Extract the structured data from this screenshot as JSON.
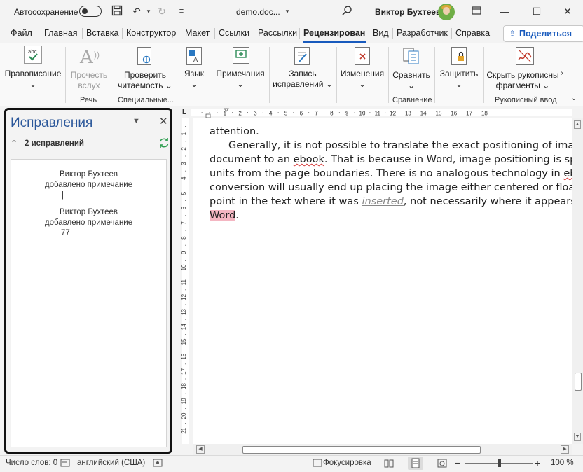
{
  "titlebar": {
    "autosave_label": "Автосохранение",
    "doc_name": "demo.doc...",
    "user_name": "Виктор Бухтеев"
  },
  "tabs": [
    "Файл",
    "Главная",
    "Вставка",
    "Конструктор",
    "Макет",
    "Ссылки",
    "Рассылки",
    "Рецензировани",
    "Вид",
    "Разработчик",
    "Справка"
  ],
  "share_label": "Поделиться",
  "ribbon": {
    "spelling": "Правописание",
    "read_aloud_1": "Прочесть",
    "read_aloud_2": "вслух",
    "check_1": "Проверить",
    "check_2": "читаемость",
    "language": "Язык",
    "comments": "Примечания",
    "track_1": "Запись",
    "track_2": "исправлений",
    "changes": "Изменения",
    "compare": "Сравнить",
    "protect": "Защитить",
    "ink_1": "Скрыть рукописны",
    "ink_2": "фрагменты",
    "group_speech": "Речь",
    "group_special": "Специальные...",
    "group_compare": "Сравнение",
    "group_ink": "Рукописный ввод"
  },
  "pane": {
    "title": "Исправления",
    "count": "2 исправлений",
    "revisions": [
      {
        "author": "Виктор Бухтеев",
        "action": "добавлено примечание",
        "content": "|"
      },
      {
        "author": "Виктор Бухтеев",
        "action": "добавлено примечание",
        "content": "77"
      }
    ]
  },
  "ruler": {
    "h_ticks": [
      "1",
      "2",
      "3",
      "4",
      "5",
      "6",
      "7",
      "8",
      "9",
      "10",
      "11",
      "12",
      "13",
      "14",
      "15",
      "16",
      "17",
      "18"
    ],
    "v_ticks": [
      "1",
      "2",
      "3",
      "4",
      "5",
      "6",
      "7",
      "8",
      "9",
      "10",
      "11",
      "12",
      "13",
      "14",
      "15",
      "16",
      "17",
      "18",
      "19",
      "20",
      "21"
    ]
  },
  "document": {
    "line0": "attention.",
    "line1": "Generally, it is not possible to translate the exact positioning of images f",
    "line2_a": "document to an ",
    "line2_b": "ebook",
    "line2_c": ". That is because in Word, image positioning is specifie",
    "line3_a": "units from the page boundaries.  There is no analogous technology in ",
    "line3_b": "ebooks",
    "line4": "conversion will usually end up placing the image either centered or floating d",
    "line5_a": "point in the text where it was ",
    "line5_b": "inserted",
    "line5_c": ", not necessarily where it appears on th",
    "line6_a": "Word",
    "line6_b": "."
  },
  "status": {
    "word_count": "Число слов: 0",
    "language": "английский (США)",
    "focus": "Фокусировка",
    "zoom": "100 %"
  }
}
